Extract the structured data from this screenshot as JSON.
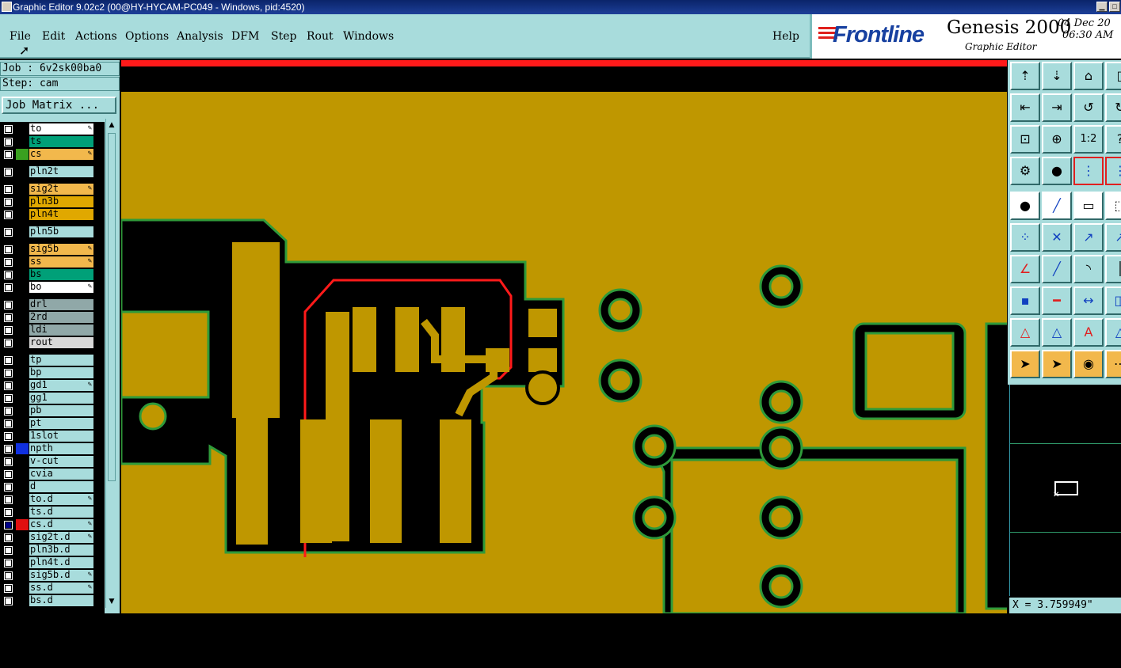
{
  "window": {
    "title": "Graphic Editor 9.02c2 (00@HY-HYCAM-PC049 - Windows, pid:4520)"
  },
  "menu": {
    "items": [
      "File",
      "Edit",
      "Actions",
      "Options",
      "Analysis",
      "DFM",
      "Step",
      "Rout",
      "Windows"
    ],
    "help": "Help"
  },
  "brand": {
    "logo": "Frontline",
    "product": "Genesis 2000",
    "subtitle": "Graphic Editor",
    "date": "04 Dec 20",
    "time": "06:30 AM"
  },
  "job": {
    "job_label": "Job : 6v2sk00ba0",
    "step_label": "Step: cam",
    "matrix_button": "Job Matrix ..."
  },
  "layers": [
    {
      "name": "to",
      "color": "#ffffff",
      "swatch": "#000",
      "edit": true
    },
    {
      "name": "ts",
      "color": "#00a078",
      "swatch": "#000",
      "edit": false
    },
    {
      "name": "cs",
      "color": "#f2b84c",
      "swatch": "#3aa020",
      "edit": true
    },
    {
      "name": "pln2t",
      "color": "#a8dcdc",
      "swatch": "#000",
      "edit": false
    },
    {
      "name": "sig2t",
      "color": "#f2b84c",
      "swatch": "#000",
      "edit": true
    },
    {
      "name": "pln3b",
      "color": "#e0a800",
      "swatch": "#000",
      "edit": false
    },
    {
      "name": "pln4t",
      "color": "#e0a800",
      "swatch": "#000",
      "edit": false
    },
    {
      "name": "pln5b",
      "color": "#a8dcdc",
      "swatch": "#000",
      "edit": false
    },
    {
      "name": "sig5b",
      "color": "#f2b84c",
      "swatch": "#000",
      "edit": true
    },
    {
      "name": "ss",
      "color": "#f2b84c",
      "swatch": "#000",
      "edit": true
    },
    {
      "name": "bs",
      "color": "#00a078",
      "swatch": "#000",
      "edit": false
    },
    {
      "name": "bo",
      "color": "#ffffff",
      "swatch": "#000",
      "edit": true
    },
    {
      "name": "drl",
      "color": "#90a8a8",
      "swatch": "#000",
      "edit": false
    },
    {
      "name": "2rd",
      "color": "#90a8a8",
      "swatch": "#000",
      "edit": false
    },
    {
      "name": "ldi",
      "color": "#90a8a8",
      "swatch": "#000",
      "edit": false
    },
    {
      "name": "rout",
      "color": "#d8d8d8",
      "swatch": "#000",
      "edit": false
    },
    {
      "name": "tp",
      "color": "#a8dcdc",
      "swatch": "#000",
      "edit": false
    },
    {
      "name": "bp",
      "color": "#a8dcdc",
      "swatch": "#000",
      "edit": false
    },
    {
      "name": "gd1",
      "color": "#a8dcdc",
      "swatch": "#000",
      "edit": true
    },
    {
      "name": "gg1",
      "color": "#a8dcdc",
      "swatch": "#000",
      "edit": false
    },
    {
      "name": "pb",
      "color": "#a8dcdc",
      "swatch": "#000",
      "edit": false
    },
    {
      "name": "pt",
      "color": "#a8dcdc",
      "swatch": "#000",
      "edit": false
    },
    {
      "name": "1slot",
      "color": "#a8dcdc",
      "swatch": "#000",
      "edit": false
    },
    {
      "name": "npth",
      "color": "#a8dcdc",
      "swatch": "#1030e0",
      "edit": false
    },
    {
      "name": "v-cut",
      "color": "#a8dcdc",
      "swatch": "#000",
      "edit": false
    },
    {
      "name": "cvia",
      "color": "#a8dcdc",
      "swatch": "#000",
      "edit": false
    },
    {
      "name": "d",
      "color": "#a8dcdc",
      "swatch": "#000",
      "edit": false
    },
    {
      "name": "to.d",
      "color": "#a8dcdc",
      "swatch": "#000",
      "edit": true
    },
    {
      "name": "ts.d",
      "color": "#a8dcdc",
      "swatch": "#000",
      "edit": false
    },
    {
      "name": "cs.d",
      "color": "#a8dcdc",
      "swatch": "#e01010",
      "edit": true,
      "checked": true
    },
    {
      "name": "sig2t.d",
      "color": "#a8dcdc",
      "swatch": "#000",
      "edit": true
    },
    {
      "name": "pln3b.d",
      "color": "#a8dcdc",
      "swatch": "#000",
      "edit": false
    },
    {
      "name": "pln4t.d",
      "color": "#a8dcdc",
      "swatch": "#000",
      "edit": false
    },
    {
      "name": "sig5b.d",
      "color": "#a8dcdc",
      "swatch": "#000",
      "edit": true
    },
    {
      "name": "ss.d",
      "color": "#a8dcdc",
      "swatch": "#000",
      "edit": true
    },
    {
      "name": "bs.d",
      "color": "#a8dcdc",
      "swatch": "#000",
      "edit": false
    }
  ],
  "coords": {
    "x": "X = 3.759949\""
  },
  "colors": {
    "board": "#bf9700",
    "copper": "#000000",
    "outline": "#2f9a3a",
    "highlight": "#ff1a1a",
    "panel": "#a8dcdc"
  }
}
